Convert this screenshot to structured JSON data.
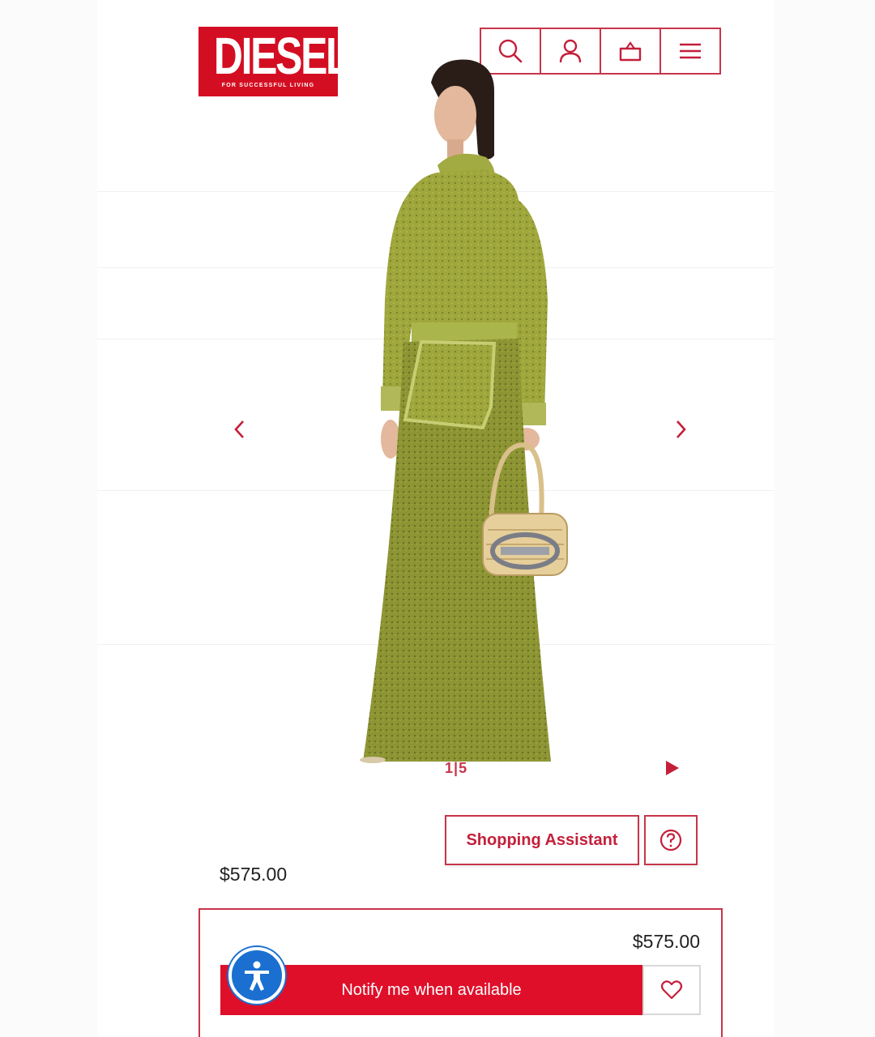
{
  "brand": {
    "name": "DIESEL",
    "tagline": "FOR SUCCESSFUL LIVING",
    "color": "#d40e22"
  },
  "header": {
    "icons": [
      "search-icon",
      "account-icon",
      "basket-icon",
      "menu-icon"
    ]
  },
  "gallery": {
    "current": "1",
    "separator": "|",
    "total": "5",
    "prev_icon": "chevron-left-icon",
    "next_icon": "chevron-right-icon",
    "play_icon": "play-icon"
  },
  "assistant": {
    "label": "Shopping Assistant",
    "help_icon": "question-icon"
  },
  "product": {
    "price": "$575.00"
  },
  "purchase_bar": {
    "price": "$575.00",
    "notify_label": "Notify me when available",
    "wishlist_icon": "heart-icon",
    "accessibility_icon": "accessibility-icon"
  },
  "colors": {
    "accent": "#c8354a",
    "cta": "#df0f2a",
    "a11y": "#1a6fd1"
  }
}
